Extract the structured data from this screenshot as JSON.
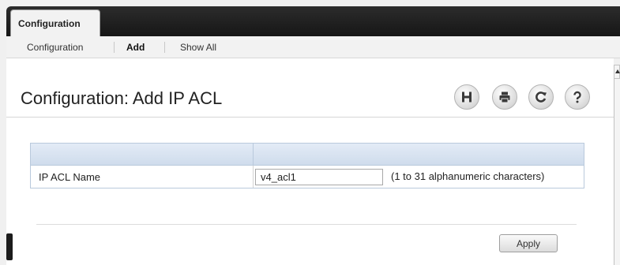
{
  "header": {
    "main_tab": "Configuration",
    "subnav": [
      {
        "label": "Configuration",
        "active": false
      },
      {
        "label": "Add",
        "active": true
      },
      {
        "label": "Show All",
        "active": false
      }
    ]
  },
  "page": {
    "title": "Configuration: Add IP ACL"
  },
  "toolbar_icons": [
    "save-icon",
    "print-icon",
    "refresh-icon",
    "help-icon"
  ],
  "form": {
    "rows": [
      {
        "label": "IP ACL Name",
        "value": "v4_acl1",
        "hint": "(1 to 31 alphanumeric characters)"
      }
    ]
  },
  "actions": {
    "apply_label": "Apply"
  },
  "colors": {
    "header_dark": "#1f1f1f",
    "table_header": "#d6e1ef",
    "table_border": "#b9c9dc"
  }
}
